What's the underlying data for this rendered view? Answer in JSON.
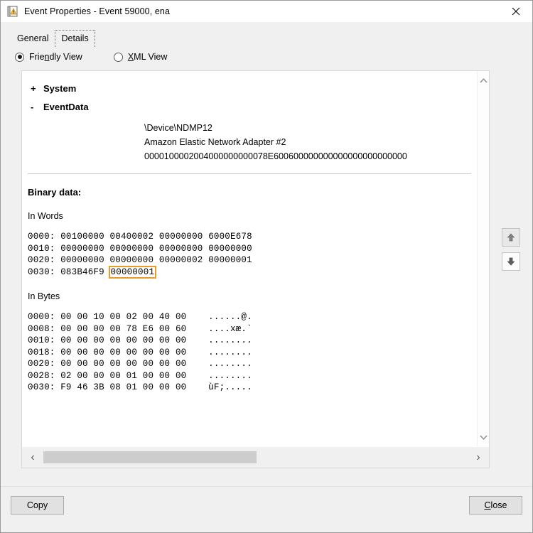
{
  "window": {
    "title": "Event Properties - Event 59000, ena",
    "icon": "event-viewer-icon",
    "close_icon": "close-icon"
  },
  "tabs": [
    {
      "label": "General",
      "selected": false
    },
    {
      "label": "Details",
      "selected": true
    }
  ],
  "view_options": [
    {
      "label_before": "Frie",
      "mnemonic": "n",
      "label_after": "dly View",
      "selected": true,
      "name": "friendly-view"
    },
    {
      "label_before": "",
      "mnemonic": "X",
      "label_after": "ML View",
      "selected": false,
      "name": "xml-view"
    }
  ],
  "details": {
    "tree": [
      {
        "toggle": "+",
        "label": "System",
        "expanded": false
      },
      {
        "toggle": "-",
        "label": "EventData",
        "expanded": true
      }
    ],
    "event_data_values": [
      "\\Device\\NDMP12",
      "Amazon Elastic Network Adapter #2",
      "0000100002004000000000078E600600000000000000000000000"
    ],
    "binary_data_heading": "Binary data:",
    "words_heading": "In Words",
    "words_rows": [
      {
        "offset": "0000:",
        "words": [
          "00100000",
          "00400002",
          "00000000",
          "6000E678"
        ]
      },
      {
        "offset": "0010:",
        "words": [
          "00000000",
          "00000000",
          "00000000",
          "00000000"
        ]
      },
      {
        "offset": "0020:",
        "words": [
          "00000000",
          "00000000",
          "00000002",
          "00000001"
        ]
      },
      {
        "offset": "0030:",
        "words": [
          "083B46F9",
          "00000001"
        ]
      }
    ],
    "highlight": {
      "row": 3,
      "word_index": 1,
      "color": "#E89B2B"
    },
    "bytes_heading": "In Bytes",
    "bytes_rows": [
      {
        "offset": "0000:",
        "bytes": "00 00 10 00 02 00 40 00",
        "ascii": "......@."
      },
      {
        "offset": "0008:",
        "bytes": "00 00 00 00 78 E6 00 60",
        "ascii": "....xæ.`"
      },
      {
        "offset": "0010:",
        "bytes": "00 00 00 00 00 00 00 00",
        "ascii": "........"
      },
      {
        "offset": "0018:",
        "bytes": "00 00 00 00 00 00 00 00",
        "ascii": "........"
      },
      {
        "offset": "0020:",
        "bytes": "00 00 00 00 00 00 00 00",
        "ascii": "........"
      },
      {
        "offset": "0028:",
        "bytes": "02 00 00 00 01 00 00 00",
        "ascii": "........"
      },
      {
        "offset": "0030:",
        "bytes": "F9 46 3B 08 01 00 00 00",
        "ascii": "ùF;....."
      }
    ]
  },
  "side_buttons": [
    {
      "name": "previous-event-button",
      "icon": "arrow-up-icon"
    },
    {
      "name": "next-event-button",
      "icon": "arrow-down-icon"
    }
  ],
  "scrollbars": {
    "vertical": {
      "up_icon": "chevron-up-icon",
      "down_icon": "chevron-down-icon"
    },
    "horizontal": {
      "left_icon": "chevron-left-icon",
      "right_icon": "chevron-right-icon",
      "left_glyph": "‹",
      "right_glyph": "›"
    }
  },
  "footer": {
    "copy_label": "Copy",
    "close_label_before": "",
    "close_mnemonic": "C",
    "close_label_after": "lose"
  }
}
